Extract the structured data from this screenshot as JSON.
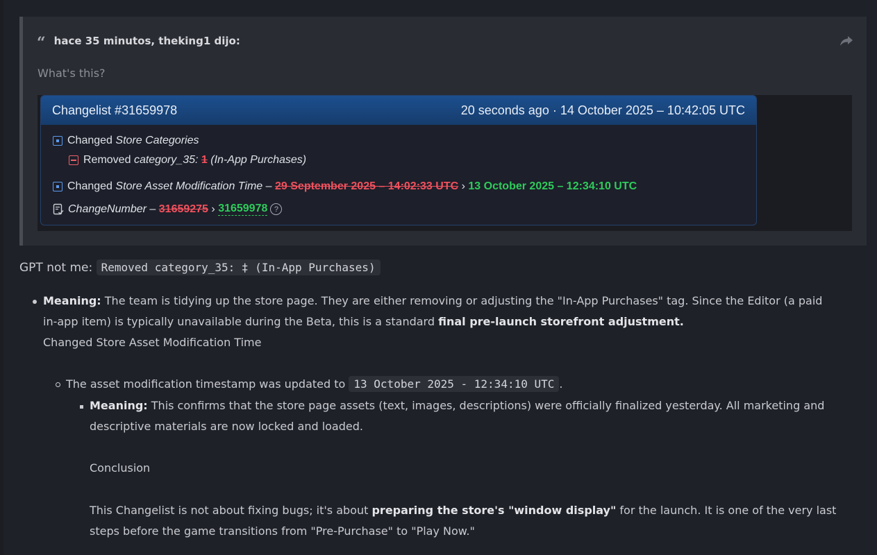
{
  "quote": {
    "author_line": "hace 35 minutos, theking1 dijo:",
    "text": "What's this?"
  },
  "changelist": {
    "title": "Changelist #31659978",
    "timestamp": "20 seconds ago · 14 October 2025 – 10:42:05 UTC",
    "row1_prefix": "Changed",
    "row1_item": "Store Categories",
    "row2_prefix": "Removed",
    "row2_item": "category_35:",
    "row2_old": "1",
    "row2_suffix": "(In-App Purchases)",
    "row3_prefix": "Changed",
    "row3_item": "Store Asset Modification Time",
    "row3_sep": "–",
    "row3_old": "29 September 2025 – 14:02:33 UTC",
    "row3_arrow": "›",
    "row3_new": "13 October 2025 – 12:34:10 UTC",
    "row4_item": "ChangeNumber",
    "row4_sep": "–",
    "row4_old": "31659275",
    "row4_arrow": "›",
    "row4_new": "31659978",
    "help": "?"
  },
  "post": {
    "gpt_label": "GPT not me:",
    "gpt_code": "Removed category_35: ‡ (In-App Purchases)",
    "b1_bold": "Meaning:",
    "b1_text": " The team is tidying up the store page. They are either removing or adjusting the \"In-App Purchases\" tag. Since the Editor (a paid",
    "b1_text2": "in-app item) is typically unavailable during the Beta, this is a standard ",
    "b1_bold2": "final pre-launch storefront adjustment.",
    "b1_line3": "Changed Store Asset Modification Time",
    "sub1_text": "The asset modification timestamp was updated to",
    "sub1_code": "13 October 2025 - 12:34:10 UTC",
    "sub1_end": ".",
    "sub2_bold": "Meaning:",
    "sub2_text": " This confirms that the store page assets (text, images, descriptions) were officially finalized yesterday. All marketing and",
    "sub2_text2": "descriptive materials are now locked and loaded.",
    "conclusion": "Conclusion",
    "concl_text1": "This Changelist is not about fixing bugs; it's about ",
    "concl_bold": "preparing the store's \"window display\"",
    "concl_text2": " for the launch. It is one of the very last",
    "concl_text3": "steps before the game transitions from \"Pre-Purchase\" to \"Play Now.\""
  }
}
